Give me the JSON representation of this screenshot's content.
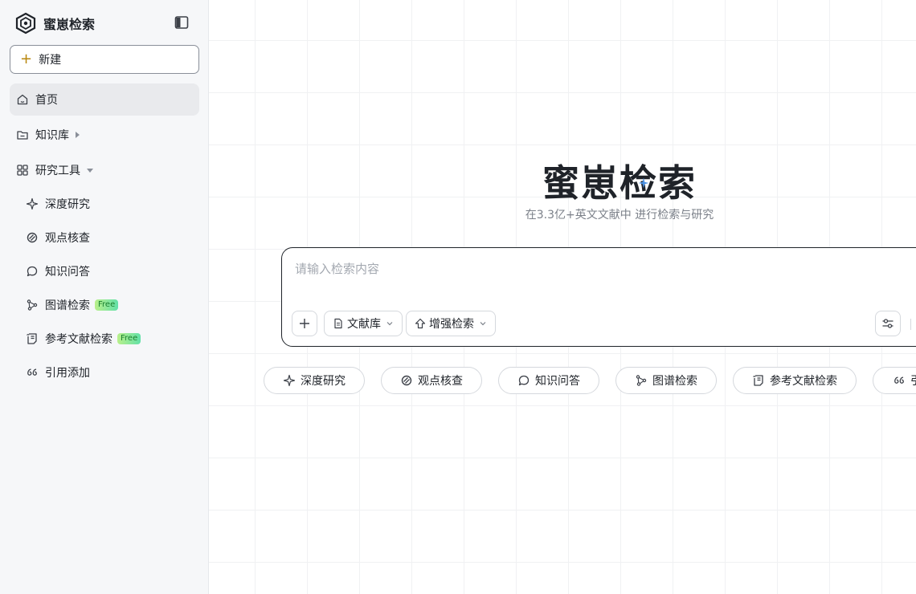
{
  "brand": {
    "name": "蜜崽检索"
  },
  "sidebar": {
    "new_label": "新建",
    "items": [
      {
        "label": "首页",
        "icon": "home-icon"
      },
      {
        "label": "知识库",
        "icon": "folder-icon"
      },
      {
        "label": "研究工具",
        "icon": "grid-icon"
      }
    ],
    "tools": [
      {
        "label": "深度研究",
        "icon": "sparkle-icon"
      },
      {
        "label": "观点核查",
        "icon": "check-view-icon"
      },
      {
        "label": "知识问答",
        "icon": "chat-icon"
      },
      {
        "label": "图谱检索",
        "icon": "graph-icon",
        "badge": "Free"
      },
      {
        "label": "参考文献检索",
        "icon": "document-icon",
        "badge": "Free"
      },
      {
        "label": "引用添加",
        "icon": "quote-icon"
      }
    ]
  },
  "hero": {
    "title": "蜜崽检索",
    "subtitle": "在3.3亿+英文文献中 进行检索与研究"
  },
  "search": {
    "placeholder": "请输入检索内容",
    "library_label": "文献库",
    "enhance_label": "增强检索"
  },
  "chips": [
    {
      "label": "深度研究",
      "icon": "sparkle-icon"
    },
    {
      "label": "观点核查",
      "icon": "check-view-icon"
    },
    {
      "label": "知识问答",
      "icon": "chat-icon"
    },
    {
      "label": "图谱检索",
      "icon": "graph-icon"
    },
    {
      "label": "参考文献检索",
      "icon": "document-icon"
    },
    {
      "label": "引",
      "icon": "quote-icon"
    }
  ],
  "colors": {
    "accent": "#b8860b",
    "badge_text": "#1a7f2e",
    "star": "#4a90e2"
  }
}
